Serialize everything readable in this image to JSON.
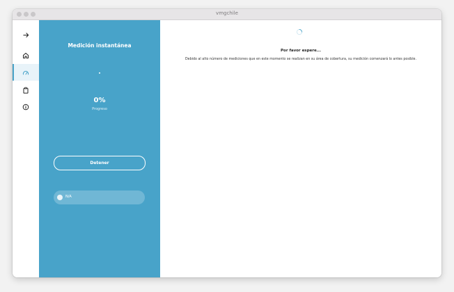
{
  "window": {
    "title": "vmgchile"
  },
  "rail": {
    "items": [
      {
        "name": "arrow-right-icon"
      },
      {
        "name": "home-icon"
      },
      {
        "name": "speedometer-icon"
      },
      {
        "name": "clipboard-icon"
      },
      {
        "name": "info-icon"
      }
    ],
    "active_color": "#48a3c9"
  },
  "panel": {
    "title": "Medición instantánea",
    "progress_value": "0%",
    "progress_label": "Progreso",
    "stop_button": "Detener",
    "server_label": "N/A",
    "background": "#48a3c9"
  },
  "main": {
    "wait_title": "Por favor espere...",
    "wait_message": "Debido al alto número de mediciones que en este momento se realizan en su área de cobertura, su medición comenzará lo antes posible."
  }
}
